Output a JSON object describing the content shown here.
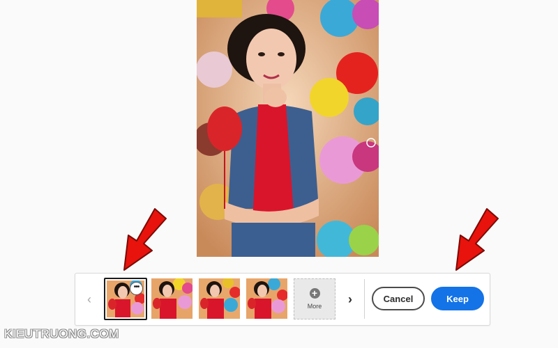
{
  "variations": {
    "items": [
      {
        "id": 1,
        "selected": true,
        "has_menu": true,
        "menu_glyph": "•••"
      },
      {
        "id": 2,
        "selected": false
      },
      {
        "id": 3,
        "selected": false
      },
      {
        "id": 4,
        "selected": false
      }
    ],
    "more_label": "More",
    "more_icon": "plus-icon"
  },
  "actions": {
    "cancel_label": "Cancel",
    "keep_label": "Keep"
  },
  "nav": {
    "prev_glyph": "‹",
    "next_glyph": "›"
  },
  "colors": {
    "primary": "#1473e6",
    "annotation_arrow": "#e8130c"
  },
  "watermark": "KIEUTRUONG.COM"
}
